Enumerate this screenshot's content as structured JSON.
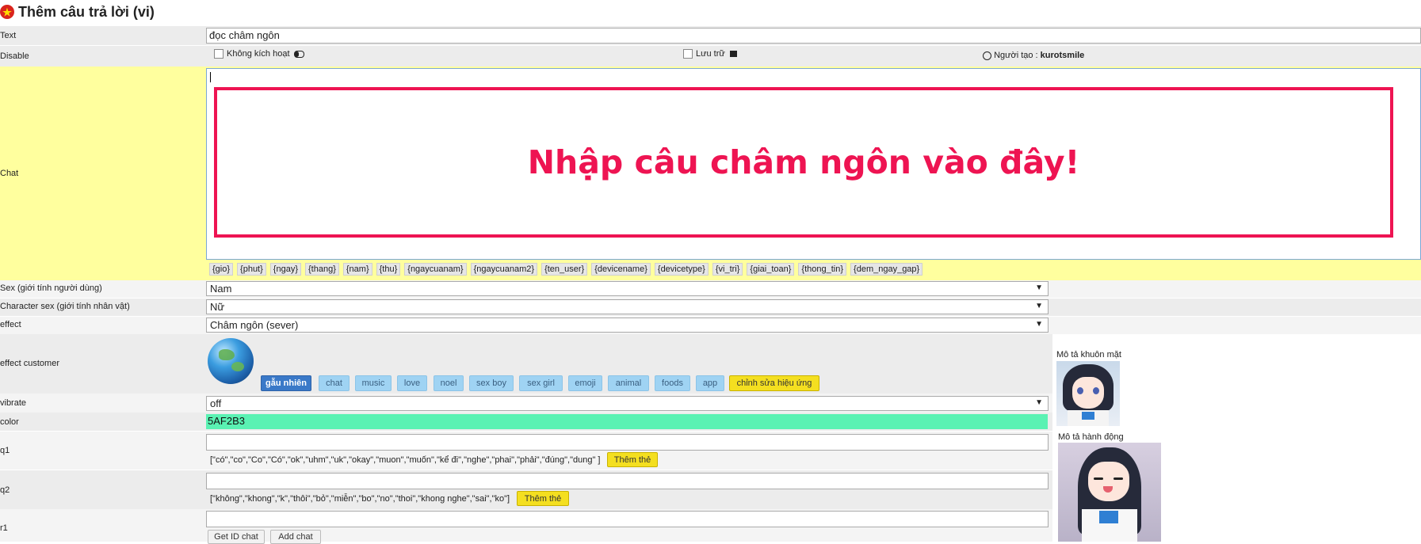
{
  "page": {
    "title": "Thêm câu trả lời (vi)",
    "flag_icon": "vietnam-flag-icon"
  },
  "text_row": {
    "label": "Text",
    "value": "đọc châm ngôn"
  },
  "disable_row": {
    "label": "Disable",
    "disable_label": "Không kích hoạt",
    "disable_icon": "toggle-icon",
    "archive_label": "Lưu trữ",
    "archive_icon": "archive-box-icon",
    "creator_icon": "user-circle-icon",
    "creator_label": "Người tạo :",
    "creator_name": "kurotsmile"
  },
  "chat_row": {
    "label": "Chat",
    "value": "",
    "overlay_text": "Nhập câu châm ngôn vào đây!",
    "tags": [
      "{gio}",
      "{phut}",
      "{ngay}",
      "{thang}",
      "{nam}",
      "{thu}",
      "{ngaycuanam}",
      "{ngaycuanam2}",
      "{ten_user}",
      "{devicename}",
      "{devicetype}",
      "{vi_tri}",
      "{giai_toan}",
      "{thong_tin}",
      "{dem_ngay_gap}"
    ]
  },
  "sex_row": {
    "label": "Sex (giới tính người dùng)",
    "value": "Nam"
  },
  "character_sex_row": {
    "label": "Character sex (giới tính nhân vật)",
    "value": "Nữ"
  },
  "effect_row": {
    "label": "effect",
    "value": "Châm ngôn (sever)"
  },
  "effect_customer_row": {
    "label": "effect customer",
    "globe_icon": "globe-icon",
    "buttons": [
      "gẫu nhiên",
      "chat",
      "music",
      "love",
      "noel",
      "sex boy",
      "sex girl",
      "emoji",
      "animal",
      "foods",
      "app"
    ],
    "edit_button": "chỉnh sửa hiệu ứng"
  },
  "vibrate_row": {
    "label": "vibrate",
    "value": "off"
  },
  "color_row": {
    "label": "color",
    "value": "5AF2B3",
    "swatch_color": "#5AF2B3"
  },
  "q1_row": {
    "label": "q1",
    "value": "",
    "hint": "[\"có\",\"co\",\"Co\",\"Có\",\"ok\",\"uhm\",\"uk\",\"okay\",\"muon\",\"muốn\",\"kể đi\",\"nghe\",\"phai\",\"phải\",\"đúng\",\"dung\" ]",
    "add_button": "Thêm thẻ"
  },
  "q2_row": {
    "label": "q2",
    "value": "",
    "hint": "[\"không\",\"khong\",\"k\",\"thôi\",\"bỏ\",\"miễn\",\"bo\",\"no\",\"thoi\",\"khong nghe\",\"sai\",\"ko\"]",
    "add_button": "Thêm thẻ"
  },
  "r1_row": {
    "label": "r1",
    "value": "",
    "get_id_button": "Get ID chat",
    "add_chat_button": "Add chat"
  },
  "side_panel": {
    "face_label": "Mô tả khuôn mặt",
    "action_label": "Mô tả hành động"
  },
  "colors": {
    "chat_bg": "#ffff9e",
    "overlay_red": "#ee1452",
    "color_field": "#5AF2B3"
  }
}
